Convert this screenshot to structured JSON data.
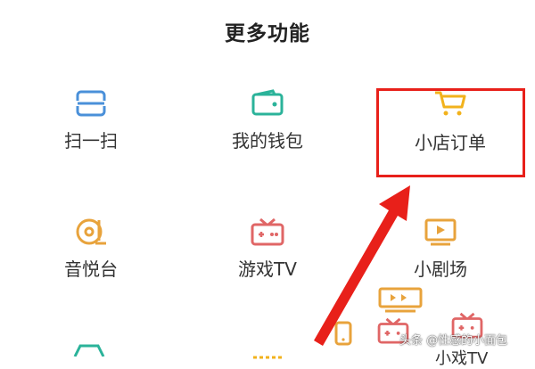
{
  "page": {
    "title": "更多功能"
  },
  "grid": [
    {
      "label": "扫一扫",
      "icon": "scan-icon",
      "color": "#4a90d9"
    },
    {
      "label": "我的钱包",
      "icon": "wallet-icon",
      "color": "#2bb39a"
    },
    {
      "label": "小店订单",
      "icon": "shopping-cart-icon",
      "color": "#f2b21c"
    },
    {
      "label": "音悦台",
      "icon": "music-disc-icon",
      "color": "#e8a33c"
    },
    {
      "label": "游戏TV",
      "icon": "game-tv-icon",
      "color": "#e06666"
    },
    {
      "label": "小剧场",
      "icon": "theater-play-icon",
      "color": "#e8a33c"
    }
  ],
  "next_row_partial": {
    "label": "小戏TV"
  },
  "annotation": {
    "highlight_color": "#e8201a",
    "target": "小店订单"
  },
  "watermark": {
    "text": "头条 @性感的小面包"
  }
}
